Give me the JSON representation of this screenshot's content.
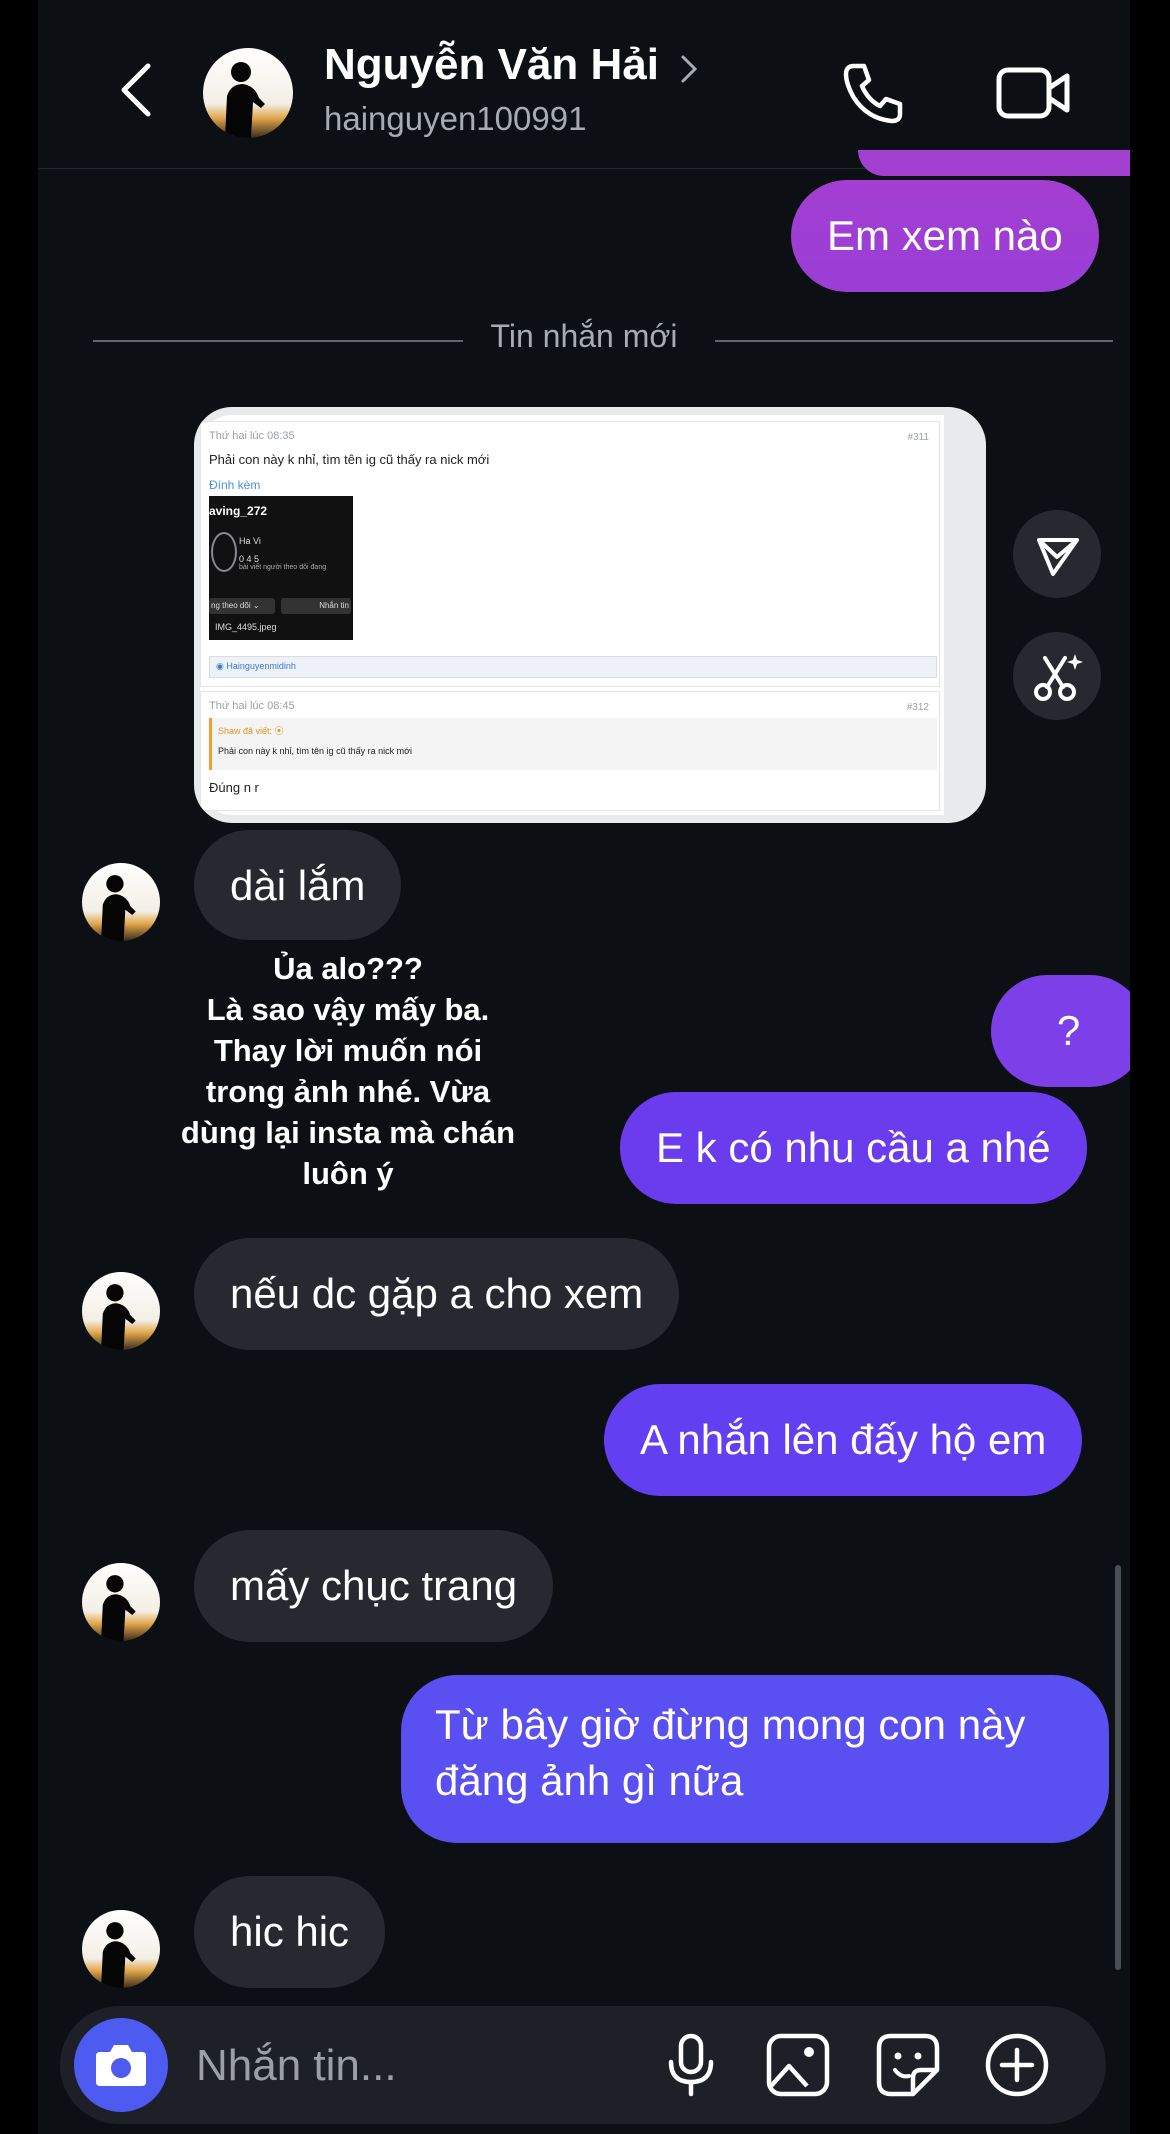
{
  "header": {
    "contact_name": "Nguyễn Văn Hải",
    "username": "hainguyen100991",
    "icons": [
      "back-icon",
      "chevron-right-icon",
      "phone-icon",
      "video-camera-icon"
    ]
  },
  "separator": {
    "label": "Tin nhắn mới"
  },
  "messages": [
    {
      "from": "me",
      "text": "Em xem nào"
    },
    {
      "from": "them",
      "text": "dài lắm"
    },
    {
      "from": "me",
      "text": "?"
    },
    {
      "from": "me",
      "text": "E k có nhu cầu a nhé"
    },
    {
      "from": "them",
      "text": "nếu dc gặp a cho xem"
    },
    {
      "from": "me",
      "text": "A nhắn lên đấy hộ em"
    },
    {
      "from": "them",
      "text": "mấy chục trang"
    },
    {
      "from": "me",
      "text": "Từ bây giờ đừng mong con này\nđăng ảnh gì nữa"
    },
    {
      "from": "them",
      "text": "hic hic"
    }
  ],
  "shared_screenshot": {
    "post1": {
      "time": "Thứ hai lúc 08:35",
      "id": "#311",
      "text": "Phải con này k nhỉ, tìm tên ig cũ thấy ra nick mới",
      "attach_label": "Đính kèm",
      "card_username": "aving_272",
      "card_name": "Ha Vi",
      "card_stats": "0        4          5",
      "card_stats_labels": "bài viết  người theo dõi  đang",
      "card_follow": "ng theo dõi ⌄",
      "card_message": "Nhắn tin",
      "card_filename": "IMG_4495.jpeg",
      "credit": "Hainguyenmidinh"
    },
    "post2": {
      "time": "Thứ hai lúc 08:45",
      "id": "#312",
      "quote_author": "Shaw đã viết: ⦿",
      "quote_text": "Phải con này k nhỉ, tìm tên ig cũ thấy ra nick mới",
      "text": "Đúng n r"
    }
  },
  "overlay_caption": "Ủa alo???\nLà sao vậy mấy ba.\nThay lời muốn nói\ntrong ảnh nhé. Vừa\ndùng lại insta mà chán\nluôn ý",
  "composer": {
    "placeholder": "Nhắn tin...",
    "icons": [
      "camera-icon",
      "microphone-icon",
      "image-icon",
      "sticker-icon",
      "plus-circle-icon"
    ]
  },
  "colors": {
    "background": "#0c0f14",
    "outgoing_bubble_top": "#a33fd1",
    "outgoing_bubble_bottom": "#5a4ff0",
    "incoming_bubble": "#262a30",
    "camera_button": "#4d5bf0"
  }
}
